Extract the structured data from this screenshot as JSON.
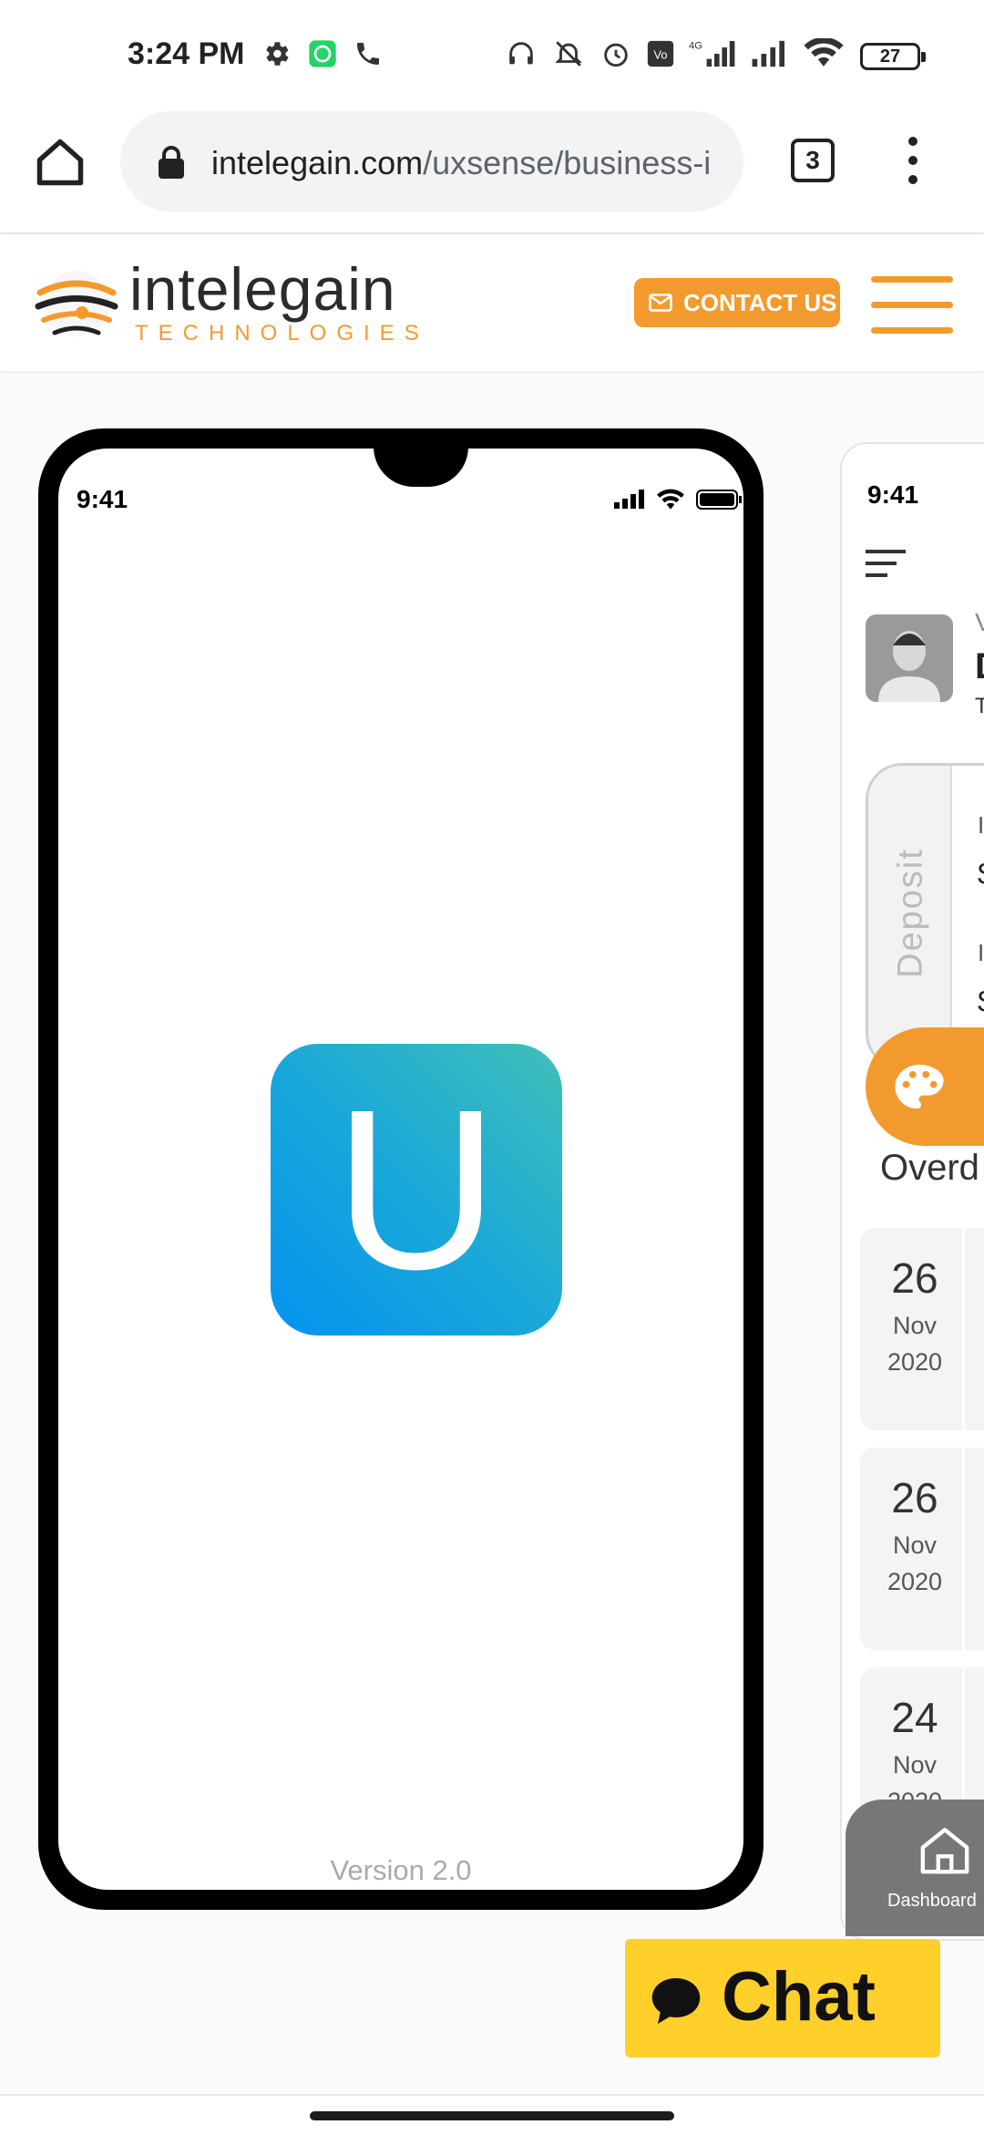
{
  "status_bar": {
    "time": "3:24 PM",
    "battery": "27",
    "network": "4G"
  },
  "browser": {
    "url_host": "intelegain.com",
    "url_path": "/uxsense/business-i",
    "tab_count": "3"
  },
  "site_header": {
    "logo_word": "intelegain",
    "logo_subtitle": "TECHNOLOGIES",
    "contact_label": "CONTACT US",
    "accent_color": "#f39a2e"
  },
  "splash_phone": {
    "time": "9:41",
    "app_letter": "U",
    "version": "Version 2.0",
    "gradient_start": "#0393f0",
    "gradient_end": "#40c0b8"
  },
  "dashboard_phone": {
    "time": "9:41",
    "greeting_initial": "V",
    "name_initial": "D",
    "subtitle_initial": "T",
    "deposit_label": "Deposit",
    "card_line1": "I",
    "card_line2": "$",
    "card_line3": "I",
    "card_line4": "$",
    "overdue_heading": "Overd",
    "dates": [
      {
        "day": "26",
        "month": "Nov",
        "year": "2020"
      },
      {
        "day": "26",
        "month": "Nov",
        "year": "2020"
      },
      {
        "day": "24",
        "month": "Nov",
        "year": "2020"
      }
    ],
    "nav_label": "Dashboard"
  },
  "chat": {
    "label": "Chat",
    "color": "#ffd02a"
  }
}
